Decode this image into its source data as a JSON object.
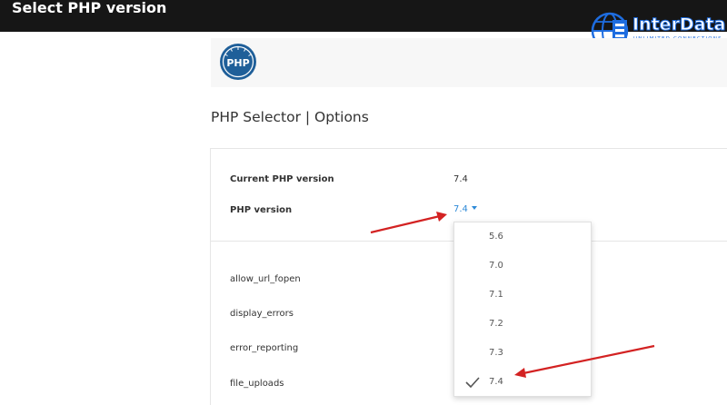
{
  "window": {
    "title": "Select PHP version"
  },
  "brand": {
    "name": "InterData",
    "tagline": "UNLIMITED CONNECTIONS"
  },
  "php_logo": {
    "text": "PHP"
  },
  "page": {
    "heading": "PHP Selector | Options"
  },
  "current": {
    "label": "Current PHP version",
    "value": "7.4"
  },
  "selector": {
    "label": "PHP version",
    "selected": "7.4"
  },
  "options": [
    "allow_url_fopen",
    "display_errors",
    "error_reporting",
    "file_uploads"
  ],
  "dropdown": {
    "items": [
      "5.6",
      "7.0",
      "7.1",
      "7.2",
      "7.3",
      "7.4"
    ],
    "checked": "7.4"
  },
  "colors": {
    "accent": "#2e8ad8",
    "annotation": "#d32222",
    "topbar": "#161616",
    "brand": "#1e6de0"
  }
}
